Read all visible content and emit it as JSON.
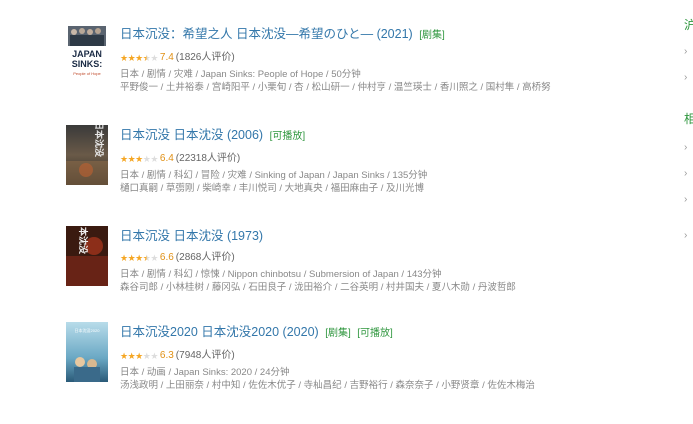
{
  "results": [
    {
      "title": "日本沉没：希望之人 日本沈没―希望のひと― (2021)",
      "tags": [
        "[剧集]"
      ],
      "stars_full": 3,
      "stars_half": 1,
      "score": "7.4",
      "count": "(1826人评价)",
      "meta": "日本 / 剧情 / 灾难 / Japan Sinks: People of Hope / 50分钟",
      "cast": "平野俊一 / 土井裕泰 / 宫崎阳平 / 小栗旬 / 杏 / 松山研一 / 仲村亨 / 温竺瑛士 / 香川照之 / 国村隼 / 高桥努",
      "poster": {
        "text_line1": "JAPAN",
        "text_line2": "SINKS:",
        "text_line3": "People of Hope"
      }
    },
    {
      "title": "日本沉没 日本沈没 (2006)",
      "tags": [
        "[可播放]"
      ],
      "stars_full": 3,
      "stars_half": 0,
      "score": "6.4",
      "count": "(22318人评价)",
      "meta": "日本 / 剧情 / 科幻 / 冒险 / 灾难 / Sinking of Japan / Japan Sinks / 135分钟",
      "cast": "樋口真嗣 / 草彅刚 / 柴崎幸 / 丰川悦司 / 大地真央 / 福田麻由子 / 及川光博",
      "poster": {
        "text_line1": "日本沈没"
      }
    },
    {
      "title": "日本沉没 日本沈没 (1973)",
      "tags": [],
      "stars_full": 3,
      "stars_half": 1,
      "score": "6.6",
      "count": "(2868人评价)",
      "meta": "日本 / 剧情 / 科幻 / 惊悚 / Nippon chinbotsu / Submersion of Japan / 143分钟",
      "cast": "森谷司郎 / 小林桂树 / 藤冈弘 / 石田良子 / 泷田裕介 / 二谷英明 / 村井国夫 / 夏八木勋 / 丹波哲郎",
      "poster": {
        "text_line1": "日本沈没"
      }
    },
    {
      "title": "日本沉没2020 日本沈没2020 (2020)",
      "tags": [
        "[剧集]",
        "[可播放]"
      ],
      "stars_full": 3,
      "stars_half": 0,
      "score": "6.3",
      "count": "(7948人评价)",
      "meta": "日本 / 动画 / Japan Sinks: 2020 / 24分钟",
      "cast": "汤浅政明 / 上田丽奈 / 村中知 / 佐佐木优子 / 寺杣昌纪 / 吉野裕行 / 森奈奈子 / 小野贤章 / 佐佐木梅治",
      "poster": {
        "text_line1": "日本沈没2020"
      }
    }
  ],
  "colors": {
    "title": "#3377aa",
    "tag": "#2e963d",
    "star": "#f5a623",
    "score": "#e09015",
    "meta": "#888888"
  }
}
